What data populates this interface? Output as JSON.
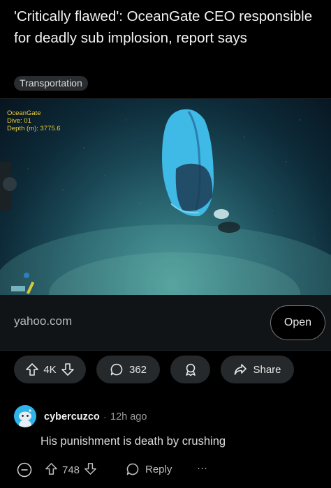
{
  "post": {
    "title": "'Critically flawed': OceanGate CEO responsible for deadly sub implosion, report says",
    "flair": "Transportation"
  },
  "embed": {
    "overlay_lines": [
      "OceanGate",
      "Dive: 01",
      "Depth (m): 3775.6"
    ],
    "domain": "yahoo.com",
    "open_label": "Open"
  },
  "actions": {
    "vote_count": "4K",
    "comment_count": "362",
    "share_label": "Share"
  },
  "comment": {
    "username": "cybercuzco",
    "separator": "·",
    "time": "12h ago",
    "body": "His punishment is death by crushing",
    "vote_count": "748",
    "reply_label": "Reply",
    "more_label": "···"
  },
  "colors": {
    "background": "#000000",
    "pill": "#25292b",
    "avatar": "#2fb4ea",
    "overlay_text": "#f0d84a"
  }
}
